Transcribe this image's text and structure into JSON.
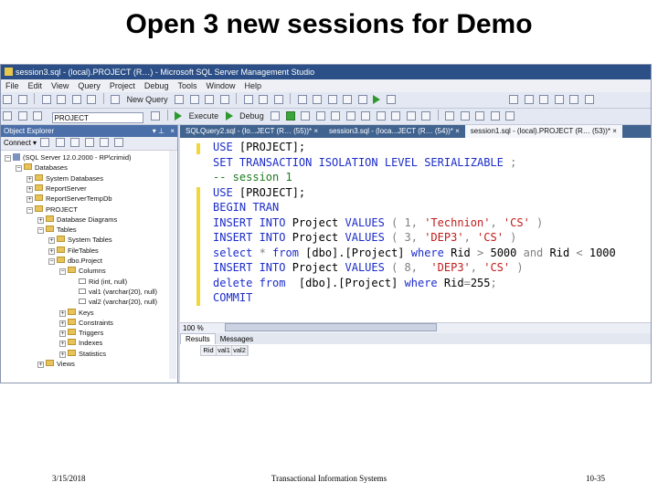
{
  "slide": {
    "title": "Open 3 new sessions for Demo",
    "footer_date": "3/15/2018",
    "footer_center": "Transactional Information Systems",
    "footer_page": "10-35"
  },
  "window": {
    "title": "session3.sql - (local).PROJECT (R…) - Microsoft SQL Server Management Studio"
  },
  "menu": [
    "File",
    "Edit",
    "View",
    "Query",
    "Project",
    "Debug",
    "Tools",
    "Window",
    "Help"
  ],
  "toolbar": {
    "new_query_label": "New Query",
    "database_value": "PROJECT",
    "execute_label": "Execute",
    "debug_label": "Debug"
  },
  "object_explorer": {
    "title": "Object Explorer",
    "connect_label": "Connect ▾",
    "nodes": [
      {
        "label": "(SQL Server 12.0.2000 - RP\\crimid)",
        "depth": 0,
        "icon": "server",
        "expander": "−"
      },
      {
        "label": "Databases",
        "depth": 1,
        "icon": "folder",
        "expander": "−"
      },
      {
        "label": "System Databases",
        "depth": 2,
        "icon": "folder",
        "expander": "+"
      },
      {
        "label": "ReportServer",
        "depth": 2,
        "icon": "folder",
        "expander": "+"
      },
      {
        "label": "ReportServerTempDb",
        "depth": 2,
        "icon": "folder",
        "expander": "+"
      },
      {
        "label": "PROJECT",
        "depth": 2,
        "icon": "folder",
        "expander": "−"
      },
      {
        "label": "Database Diagrams",
        "depth": 3,
        "icon": "folder",
        "expander": "+"
      },
      {
        "label": "Tables",
        "depth": 3,
        "icon": "folder",
        "expander": "−"
      },
      {
        "label": "System Tables",
        "depth": 4,
        "icon": "folder",
        "expander": "+"
      },
      {
        "label": "FileTables",
        "depth": 4,
        "icon": "folder",
        "expander": "+"
      },
      {
        "label": "dbo.Project",
        "depth": 4,
        "icon": "folder",
        "expander": "−"
      },
      {
        "label": "Columns",
        "depth": 5,
        "icon": "folder",
        "expander": "−"
      },
      {
        "label": "Rid (int, null)",
        "depth": 6,
        "icon": "col",
        "expander": ""
      },
      {
        "label": "val1 (varchar(20), null)",
        "depth": 6,
        "icon": "col",
        "expander": ""
      },
      {
        "label": "val2 (varchar(20), null)",
        "depth": 6,
        "icon": "col",
        "expander": ""
      },
      {
        "label": "Keys",
        "depth": 5,
        "icon": "folder",
        "expander": "+"
      },
      {
        "label": "Constraints",
        "depth": 5,
        "icon": "folder",
        "expander": "+"
      },
      {
        "label": "Triggers",
        "depth": 5,
        "icon": "folder",
        "expander": "+"
      },
      {
        "label": "Indexes",
        "depth": 5,
        "icon": "folder",
        "expander": "+"
      },
      {
        "label": "Statistics",
        "depth": 5,
        "icon": "folder",
        "expander": "+"
      },
      {
        "label": "Views",
        "depth": 3,
        "icon": "folder",
        "expander": "+"
      }
    ]
  },
  "tabs": [
    {
      "label": "SQLQuery2.sql - (lo...JECT (R… (55))*",
      "active": false
    },
    {
      "label": "session3.sql - (loca...JECT (R… (54))*",
      "active": false
    },
    {
      "label": "session1.sql - (local).PROJECT (R… (53))*",
      "active": true
    }
  ],
  "editor": {
    "lines": [
      [
        {
          "t": "USE ",
          "c": "kw"
        },
        {
          "t": "[PROJECT];",
          "c": "txt"
        }
      ],
      [
        {
          "t": "SET TRANSACTION ISOLATION LEVEL SERIALIZABLE",
          "c": "kw"
        },
        {
          "t": " ;",
          "c": "gray"
        }
      ],
      [
        {
          "t": "-- session 1",
          "c": "cm"
        }
      ],
      [
        {
          "t": "USE ",
          "c": "kw"
        },
        {
          "t": "[PROJECT];",
          "c": "txt"
        }
      ],
      [
        {
          "t": "BEGIN TRAN",
          "c": "kw"
        }
      ],
      [
        {
          "t": "INSERT INTO ",
          "c": "kw"
        },
        {
          "t": "Project ",
          "c": "txt"
        },
        {
          "t": "VALUES ",
          "c": "kw"
        },
        {
          "t": "( 1, ",
          "c": "gray"
        },
        {
          "t": "'Technion'",
          "c": "str"
        },
        {
          "t": ", ",
          "c": "gray"
        },
        {
          "t": "'CS'",
          "c": "str"
        },
        {
          "t": " )",
          "c": "gray"
        }
      ],
      [
        {
          "t": "INSERT INTO ",
          "c": "kw"
        },
        {
          "t": "Project ",
          "c": "txt"
        },
        {
          "t": "VALUES ",
          "c": "kw"
        },
        {
          "t": "( 3, ",
          "c": "gray"
        },
        {
          "t": "'DEP3'",
          "c": "str"
        },
        {
          "t": ", ",
          "c": "gray"
        },
        {
          "t": "'CS'",
          "c": "str"
        },
        {
          "t": " )",
          "c": "gray"
        }
      ],
      [
        {
          "t": "select ",
          "c": "kw"
        },
        {
          "t": "* ",
          "c": "gray"
        },
        {
          "t": "from ",
          "c": "kw"
        },
        {
          "t": "[dbo].[Project] ",
          "c": "txt"
        },
        {
          "t": "where ",
          "c": "kw"
        },
        {
          "t": "Rid ",
          "c": "txt"
        },
        {
          "t": "> ",
          "c": "gray"
        },
        {
          "t": "5000 ",
          "c": "txt"
        },
        {
          "t": "and ",
          "c": "gray"
        },
        {
          "t": "Rid ",
          "c": "txt"
        },
        {
          "t": "< ",
          "c": "gray"
        },
        {
          "t": "1000",
          "c": "txt"
        }
      ],
      [
        {
          "t": "INSERT INTO ",
          "c": "kw"
        },
        {
          "t": "Project ",
          "c": "txt"
        },
        {
          "t": "VALUES ",
          "c": "kw"
        },
        {
          "t": "( 8, ",
          "c": "gray"
        },
        {
          "t": " 'DEP3'",
          "c": "str"
        },
        {
          "t": ", ",
          "c": "gray"
        },
        {
          "t": "'CS'",
          "c": "str"
        },
        {
          "t": " )",
          "c": "gray"
        }
      ],
      [
        {
          "t": "delete ",
          "c": "kw"
        },
        {
          "t": "from ",
          "c": "kw"
        },
        {
          "t": " [dbo].[Project] ",
          "c": "txt"
        },
        {
          "t": "where ",
          "c": "kw"
        },
        {
          "t": "Rid",
          "c": "txt"
        },
        {
          "t": "=",
          "c": "gray"
        },
        {
          "t": "255",
          "c": "txt"
        },
        {
          "t": ";",
          "c": "gray"
        }
      ],
      [
        {
          "t": "COMMIT",
          "c": "kw"
        }
      ]
    ],
    "zoom_label": "100 %"
  },
  "results": {
    "tabs": [
      "Results",
      "Messages"
    ],
    "columns": [
      "Rid",
      "val1",
      "val2"
    ]
  }
}
